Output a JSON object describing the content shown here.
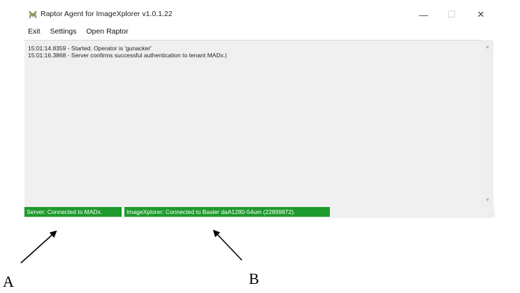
{
  "window": {
    "title": "Raptor Agent for ImageXplorer v1.0.1.22",
    "controls": {
      "minimize": "—",
      "maximize": "☐",
      "close": "✕"
    }
  },
  "menu": {
    "items": [
      "Exit",
      "Settings",
      "Open Raptor"
    ]
  },
  "log": {
    "lines": [
      "15:01:14.8359 - Started. Operator is 'gunacker'",
      "15:01:16.3868 - Server confirms successful authentication to tenant MADx.|"
    ]
  },
  "status": {
    "server": "Server: Connected to MADx.",
    "imagexplorer": "ImageXplorer: Connected to Basler daA1280-54um (22899872).",
    "color": "#1e9a2c"
  },
  "annotations": {
    "label_a": "A",
    "label_b": "B"
  }
}
